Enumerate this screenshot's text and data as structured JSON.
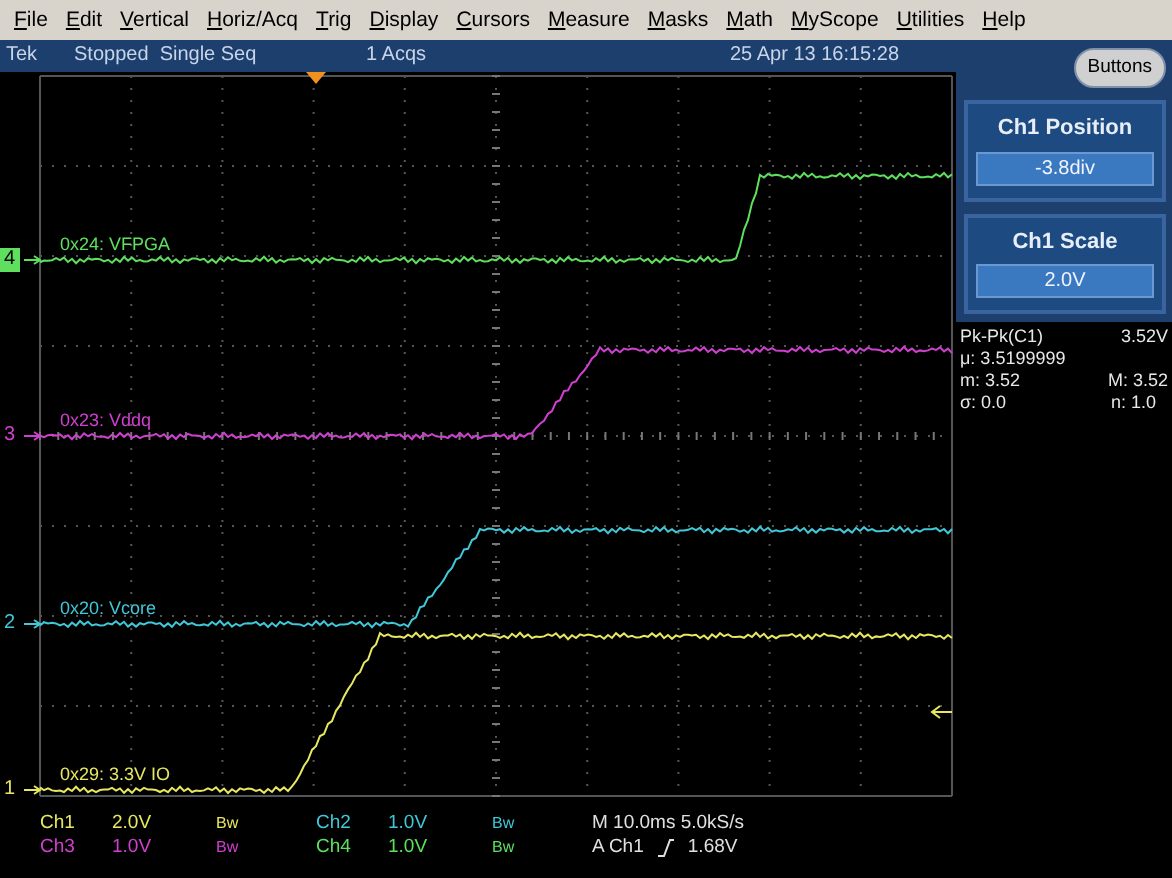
{
  "menu": [
    "File",
    "Edit",
    "Vertical",
    "Horiz/Acq",
    "Trig",
    "Display",
    "Cursors",
    "Measure",
    "Masks",
    "Math",
    "MyScope",
    "Utilities",
    "Help"
  ],
  "status_bar": {
    "brand": "Tek",
    "state": "Stopped  Single Seq",
    "acquisitions": "1 Acqs",
    "datetime": "25 Apr 13 16:15:28"
  },
  "traces": [
    {
      "marker": "4",
      "label": "0x24: VFPGA",
      "color": "#5ee05e",
      "selected": true
    },
    {
      "marker": "3",
      "label": "0x23: Vddq",
      "color": "#d040d0",
      "selected": false
    },
    {
      "marker": "2",
      "label": "0x20: Vcore",
      "color": "#40c8d8",
      "selected": false
    },
    {
      "marker": "1",
      "label": "0x29: 3.3V IO",
      "color": "#e8e860",
      "selected": false
    }
  ],
  "side_panel": {
    "button": "Buttons",
    "controls": [
      {
        "title": "Ch1 Position",
        "value": "-3.8div"
      },
      {
        "title": "Ch1 Scale",
        "value": "2.0V"
      }
    ],
    "measurement": {
      "label": "Pk-Pk(C1)",
      "value": "3.52V",
      "mean": "μ: 3.5199999",
      "min": "m: 3.52",
      "max": "M: 3.52",
      "sigma": "σ: 0.0",
      "count": "n: 1.0"
    }
  },
  "readout": {
    "channels": [
      {
        "name": "Ch1",
        "scale": "2.0V",
        "bandwidth": "Bw",
        "color": "#e8e860"
      },
      {
        "name": "Ch2",
        "scale": "1.0V",
        "bandwidth": "Bw",
        "color": "#40c8d8"
      },
      {
        "name": "Ch3",
        "scale": "1.0V",
        "bandwidth": "Bw",
        "color": "#d040d0"
      },
      {
        "name": "Ch4",
        "scale": "1.0V",
        "bandwidth": "Bw",
        "color": "#5ee05e"
      }
    ],
    "timebase": "M 10.0ms 5.0kS/s",
    "trigger_source": "A Ch1",
    "trigger_level": "1.68V"
  }
}
